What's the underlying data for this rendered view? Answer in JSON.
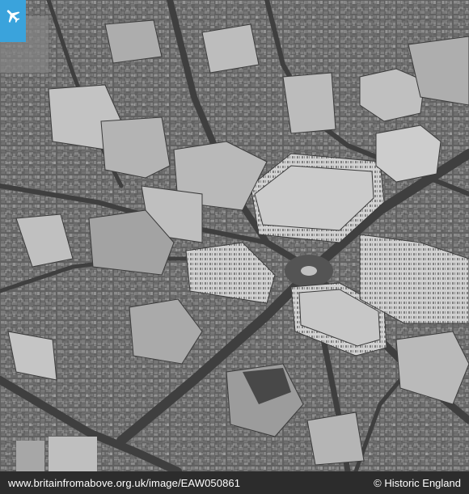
{
  "image": {
    "alt": "Black and white aerial photograph of dense city blocks with a circus road junction at centre",
    "palette": {
      "base": "#5f5f5f",
      "street": "#3a3a3a",
      "roof_light": "#b8b8b8",
      "roof_dark": "#4a4a4a"
    }
  },
  "badge": {
    "icon": "airplane-icon",
    "color": "#3aa3dc"
  },
  "footer": {
    "url": "www.britainfromabove.org.uk/image/EAW050861",
    "credit": "© Historic England",
    "background": "#2c2c2c",
    "text_color": "#ffffff"
  }
}
